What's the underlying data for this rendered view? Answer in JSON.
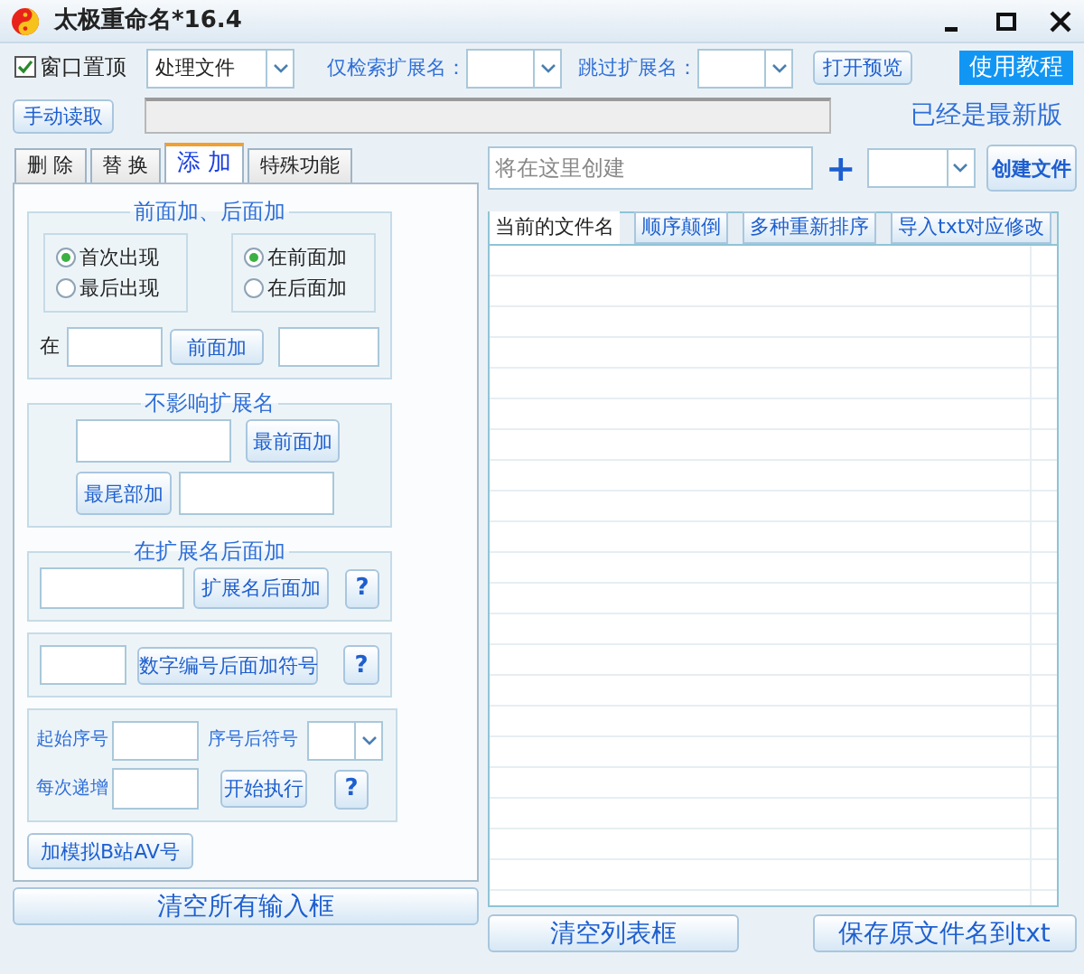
{
  "window": {
    "title": "太极重命名*16.4"
  },
  "toolbar": {
    "always_on_top": {
      "label": "窗口置顶",
      "checked": true
    },
    "mode_select": {
      "value": "处理文件"
    },
    "search_ext_label": "仅检索扩展名：",
    "skip_ext_label": "跳过扩展名：",
    "preview_button": "打开预览",
    "tutorial_button": "使用教程"
  },
  "read_button": "手动读取",
  "version_status": "已经是最新版",
  "tabs": [
    {
      "label": "删 除",
      "selected": false
    },
    {
      "label": "替 换",
      "selected": false
    },
    {
      "label": "添 加",
      "selected": true
    },
    {
      "label": "特殊功能",
      "selected": false
    }
  ],
  "prefix_suffix": {
    "title": "前面加、后面加",
    "occurrence": [
      {
        "label": "首次出现",
        "selected": true
      },
      {
        "label": "最后出现",
        "selected": false
      }
    ],
    "position": [
      {
        "label": "在前面加",
        "selected": true
      },
      {
        "label": "在后面加",
        "selected": false
      }
    ],
    "at_label": "在",
    "button": "前面加"
  },
  "keep_extension": {
    "title": "不影响扩展名",
    "front_button": "最前面加",
    "end_button": "最尾部加"
  },
  "after_extension": {
    "title": "在扩展名后面加",
    "button": "扩展名后面加",
    "help": "?"
  },
  "number_symbol": {
    "button": "数字编号后面加符号",
    "help": "?"
  },
  "sequence": {
    "start_label": "起始序号",
    "symbol_label": "序号后符号",
    "step_label": "每次递增",
    "run_button": "开始执行",
    "help": "?"
  },
  "bilibili_button": "加模拟B站AV号",
  "create": {
    "placeholder": "将在这里创建",
    "plus": "+",
    "button": "创建文件"
  },
  "list_tabs": [
    {
      "label": "当前的文件名",
      "selected": true
    },
    {
      "label": "顺序颠倒",
      "selected": false
    },
    {
      "label": "多种重新排序",
      "selected": false
    },
    {
      "label": "导入txt对应修改",
      "selected": false
    }
  ],
  "bottom_buttons": [
    "清空所有输入框",
    "清空列表框",
    "保存原文件名到txt"
  ]
}
